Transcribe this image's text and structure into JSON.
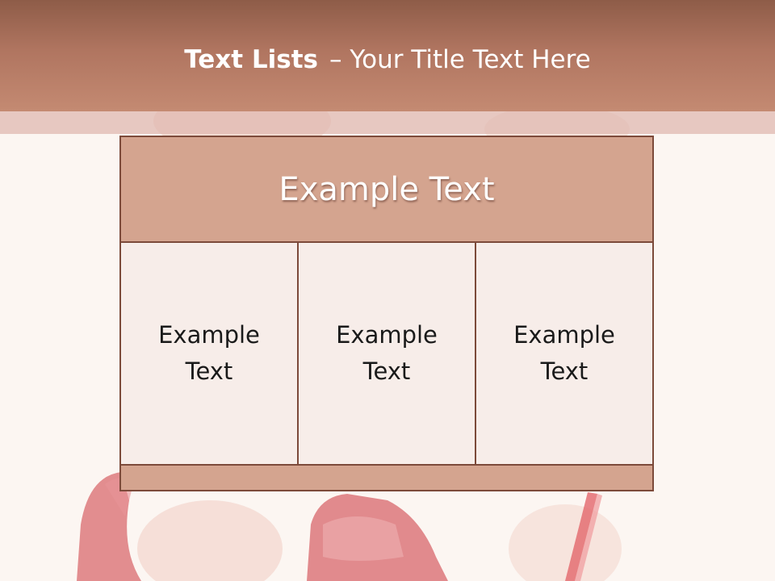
{
  "slide": {
    "title_bold": "Text Lists",
    "title_rest": "– Your Title Text Here"
  },
  "diagram": {
    "header": "Example Text",
    "cells": [
      "Example\nText",
      "Example\nText",
      "Example\nText"
    ]
  },
  "colors": {
    "title_bar": "#b07560",
    "header_fill": "#d4a48f",
    "border": "#7c4a3a",
    "cell_fill": "#f6ece8"
  }
}
